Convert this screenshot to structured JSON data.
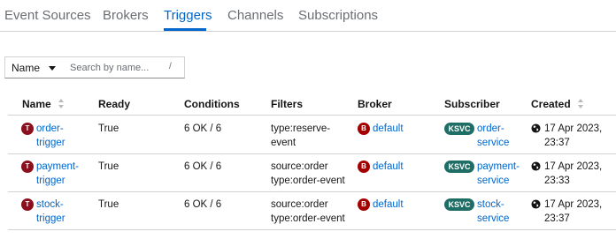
{
  "tabs": [
    {
      "label": "Event Sources",
      "active": false
    },
    {
      "label": "Brokers",
      "active": false
    },
    {
      "label": "Triggers",
      "active": true
    },
    {
      "label": "Channels",
      "active": false
    },
    {
      "label": "Subscriptions",
      "active": false
    }
  ],
  "filter": {
    "type_label": "Name",
    "search_placeholder": "Search by name...",
    "shortcut_hint": "/"
  },
  "table": {
    "columns": [
      "Name",
      "Ready",
      "Conditions",
      "Filters",
      "Broker",
      "Subscriber",
      "Created"
    ],
    "rows": [
      {
        "name_badge": "T",
        "name_line1": "order-",
        "name_line2": "trigger",
        "ready": "True",
        "conditions": "6 OK / 6",
        "filters_line1": "type:reserve-",
        "filters_line2": "event",
        "broker_badge": "B",
        "broker": "default",
        "subscriber_badge": "KSVC",
        "subscriber_line1": "order-",
        "subscriber_line2": "service",
        "created_line1": "17 Apr 2023,",
        "created_line2": "23:37"
      },
      {
        "name_badge": "T",
        "name_line1": "payment-",
        "name_line2": "trigger",
        "ready": "True",
        "conditions": "6 OK / 6",
        "filters_line1": "source:order",
        "filters_line2": "type:order-event",
        "broker_badge": "B",
        "broker": "default",
        "subscriber_badge": "KSVC",
        "subscriber_line1": "payment-",
        "subscriber_line2": "service",
        "created_line1": "17 Apr 2023,",
        "created_line2": "23:33"
      },
      {
        "name_badge": "T",
        "name_line1": "stock-",
        "name_line2": "trigger",
        "ready": "True",
        "conditions": "6 OK / 6",
        "filters_line1": "source:order",
        "filters_line2": "type:order-event",
        "broker_badge": "B",
        "broker": "default",
        "subscriber_badge": "KSVC",
        "subscriber_line1": "stock-",
        "subscriber_line2": "service",
        "created_line1": "17 Apr 2023,",
        "created_line2": "23:37"
      }
    ]
  },
  "colors": {
    "accent": "#0066cc",
    "trigger_badge": "#8b0f1c",
    "broker_badge": "#a30000",
    "ksvc_badge": "#1f6e66"
  },
  "icons": {
    "sort": "sort-icon",
    "globe": "globe-icon",
    "caret": "caret-down-icon"
  }
}
